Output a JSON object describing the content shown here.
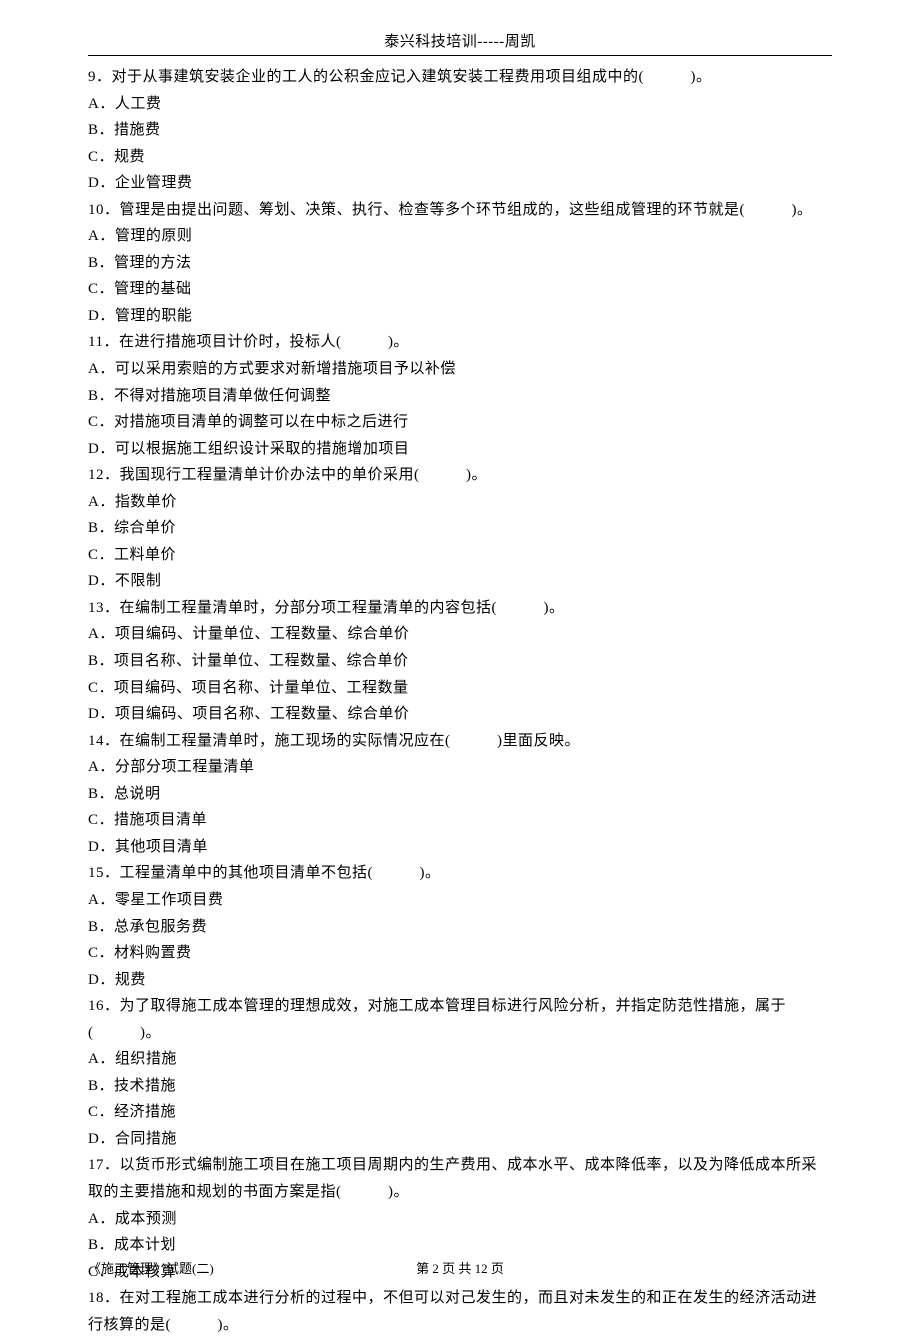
{
  "header": "泰兴科技培训-----周凯",
  "questions": [
    {
      "num": "9．",
      "text": "对于从事建筑安装企业的工人的公积金应记入建筑安装工程费用项目组成中的(　　　)。",
      "options": [
        "A．人工费",
        "B．措施费",
        "C．规费",
        "D．企业管理费"
      ]
    },
    {
      "num": "10．",
      "text": "管理是由提出问题、筹划、决策、执行、检查等多个环节组成的，这些组成管理的环节就是(　　　)。",
      "options": [
        "A．管理的原则",
        "B．管理的方法",
        "C．管理的基础",
        "D．管理的职能"
      ]
    },
    {
      "num": "11．",
      "text": "在进行措施项目计价时，投标人(　　　)。",
      "options": [
        "A．可以采用索赔的方式要求对新增措施项目予以补偿",
        "B．不得对措施项目清单做任何调整",
        "C．对措施项目清单的调整可以在中标之后进行",
        "D．可以根据施工组织设计采取的措施增加项目"
      ]
    },
    {
      "num": "12．",
      "text": "我国现行工程量清单计价办法中的单价采用(　　　)。",
      "options": [
        "A．指数单价",
        "B．综合单价",
        "C．工料单价",
        "D．不限制"
      ]
    },
    {
      "num": "13．",
      "text": "在编制工程量清单时，分部分项工程量清单的内容包括(　　　)。",
      "options": [
        "A．项目编码、计量单位、工程数量、综合单价",
        "B．项目名称、计量单位、工程数量、综合单价",
        "C．项目编码、项目名称、计量单位、工程数量",
        "D．项目编码、项目名称、工程数量、综合单价"
      ]
    },
    {
      "num": "14．",
      "text": "在编制工程量清单时，施工现场的实际情况应在(　　　)里面反映。",
      "options": [
        "A．分部分项工程量清单",
        "B．总说明",
        "C．措施项目清单",
        "D．其他项目清单"
      ]
    },
    {
      "num": "15．",
      "text": "工程量清单中的其他项目清单不包括(　　　)。",
      "options": [
        "A．零星工作项目费",
        "B．总承包服务费",
        "C．材料购置费",
        "D．规费"
      ]
    },
    {
      "num": "16．",
      "text": "为了取得施工成本管理的理想成效，对施工成本管理目标进行风险分析，并指定防范性措施，属于(　　　)。",
      "options": [
        "A．组织措施",
        "B．技术措施",
        "C．经济措施",
        "D．合同措施"
      ]
    },
    {
      "num": "17．",
      "text": "以货币形式编制施工项目在施工项目周期内的生产费用、成本水平、成本降低率，以及为降低成本所采取的主要措施和规划的书面方案是指(　　　)。",
      "options": [
        "A．成本预测",
        "B．成本计划",
        "C．成本核算"
      ]
    },
    {
      "num": "18．",
      "text": "在对工程施工成本进行分析的过程中，不但可以对己发生的，而且对未发生的和正在发生的经济活动进行核算的是(　　　)。",
      "options": []
    }
  ],
  "footer": {
    "left": "《施工管理》试题(二)",
    "center": "第 2 页 共 12 页"
  }
}
